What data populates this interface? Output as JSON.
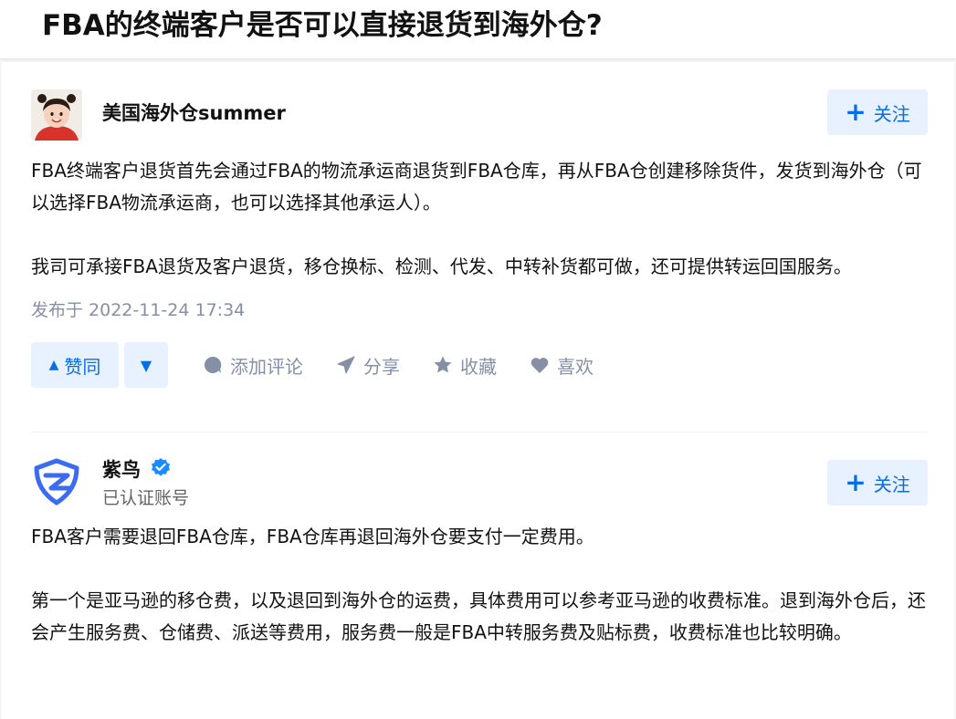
{
  "question": {
    "title": "FBA的终端客户是否可以直接退货到海外仓?"
  },
  "answers": [
    {
      "author": {
        "name": "美国海外仓summer",
        "avatar": "child-photo-avatar"
      },
      "follow_label": "关注",
      "paragraphs": [
        "FBA终端客户退货首先会通过FBA的物流承运商退货到FBA仓库，再从FBA仓创建移除货件，发货到海外仓（可以选择FBA物流承运商，也可以选择其他承运人）。",
        "我司可承接FBA退货及客户退货，移仓换标、检测、代发、中转补货都可做，还可提供转运回国服务。"
      ],
      "publish_time": "发布于 2022-11-24 17:34",
      "actions": {
        "upvote_label": "赞同",
        "comment_label": "添加评论",
        "share_label": "分享",
        "collect_label": "收藏",
        "like_label": "喜欢"
      }
    },
    {
      "author": {
        "name": "紫鸟",
        "badge_text": "已认证账号",
        "avatar": "ziniao-logo"
      },
      "follow_label": "关注",
      "paragraphs": [
        "FBA客户需要退回FBA仓库，FBA仓库再退回海外仓要支付一定费用。",
        "第一个是亚马逊的移仓费，以及退回到海外仓的运费，具体费用可以参考亚马逊的收费标准。退到海外仓后，还会产生服务费、仓储费、派送等费用，服务费一般是FBA中转服务费及贴标费，收费标准也比较明确。"
      ]
    }
  ],
  "colors": {
    "brand_blue": "#056de8",
    "button_bg": "#e8f1ff",
    "muted_text": "#8590a6",
    "verified_blue": "#1a8cff"
  },
  "icons": [
    "plus-icon",
    "upvote-triangle-icon",
    "downvote-triangle-icon",
    "comment-bubble-icon",
    "share-paper-plane-icon",
    "star-icon",
    "heart-icon",
    "verified-badge-icon"
  ]
}
